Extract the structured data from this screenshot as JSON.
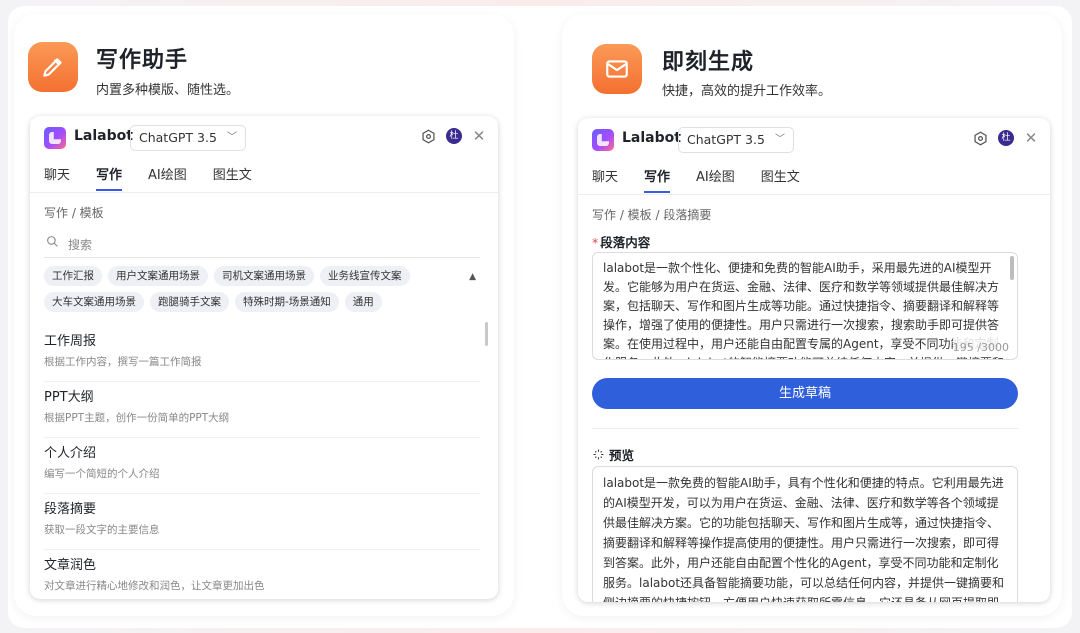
{
  "left_card": {
    "title": "写作助手",
    "subtitle": "内置多种模版、随性选。",
    "icon": "pencil-icon",
    "window": {
      "app_name": "Lalabot",
      "model": "ChatGPT 3.5",
      "avatar_text": "杜",
      "tabs": [
        "聊天",
        "写作",
        "AI绘图",
        "图生文"
      ],
      "active_tab": "写作",
      "breadcrumb": "写作 / 模板",
      "search_placeholder": "搜索",
      "tags": [
        "工作汇报",
        "用户文案通用场景",
        "司机文案通用场景",
        "业务线宣传文案",
        "大车文案通用场景",
        "跑腿骑手文案",
        "特殊时期-场景通知",
        "通用"
      ],
      "templates": [
        {
          "title": "工作周报",
          "desc": "根据工作内容，撰写一篇工作简报"
        },
        {
          "title": "PPT大纲",
          "desc": "根据PPT主题，创作一份简单的PPT大纲"
        },
        {
          "title": "个人介绍",
          "desc": "编写一个简短的个人介绍"
        },
        {
          "title": "段落摘要",
          "desc": "获取一段文字的主要信息"
        },
        {
          "title": "文章润色",
          "desc": "对文章进行精心地修改和润色，让文章更加出色"
        }
      ]
    }
  },
  "right_card": {
    "title": "即刻生成",
    "subtitle": "快捷，高效的提升工作效率。",
    "icon": "mail-icon",
    "window": {
      "app_name": "Lalabot",
      "model": "ChatGPT 3.5",
      "avatar_text": "杜",
      "tabs": [
        "聊天",
        "写作",
        "AI绘图",
        "图生文"
      ],
      "active_tab": "写作",
      "breadcrumb": "写作 / 模板 / 段落摘要",
      "field_label": "段落内容",
      "required_mark": "*",
      "input_text": "lalabot是一款个性化、便捷和免费的智能AI助手，采用最先进的AI模型开发。它能够为用户在货运、金融、法律、医疗和数学等领域提供最佳解决方案，包括聊天、写作和图片生成等功能。通过快捷指令、摘要翻译和解释等操作，增强了使用的便捷性。用户只需进行一次搜索，搜索助手即可提供答案。在使用过程中，用户还能自由配置专属的Agent，享受不同功能和定制化服务。此外，lalabot的智能摘要功能可总结任何内容，并提供一键摘要和",
      "counter": "195 /3000",
      "generate_button": "生成草稿",
      "preview_label": "预览",
      "preview_text": "lalabot是一款免费的智能AI助手，具有个性化和便捷的特点。它利用最先进的AI模型开发，可以为用户在货运、金融、法律、医疗和数学等各个领域提供最佳解决方案。它的功能包括聊天、写作和图片生成等，通过快捷指令、摘要翻译和解释等操作提高使用的便捷性。用户只需进行一次搜索，即可得到答案。此外，用户还能自由配置个性化的Agent，享受不同功能和定制化服务。lalabot还具备智能摘要功能，可以总结任何内容，并提供一键摘要和侧边摘要的快捷按钮，方便用户快速获取所需信息。它还具备从网页提取即时"
    }
  },
  "colors": {
    "accent_blue": "#2f5fdb",
    "icon_orange": "#f47030"
  }
}
